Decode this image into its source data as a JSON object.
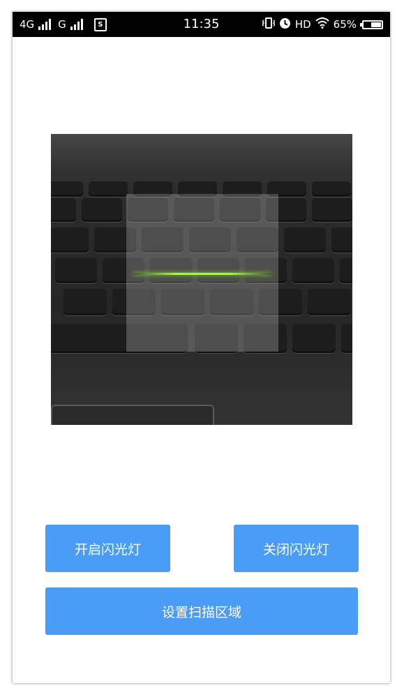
{
  "status_bar": {
    "network_1": "4G",
    "network_2": "G",
    "time": "11:35",
    "hd": "HD",
    "battery_percent": "65%",
    "battery_level": 0.65
  },
  "camera": {
    "icon": "camera-preview"
  },
  "buttons": {
    "flash_on": "开启闪光灯",
    "flash_off": "关闭闪光灯",
    "set_scan_area": "设置扫描区域"
  },
  "colors": {
    "button_bg": "#4a9cf5",
    "scan_line": "#9bff2b"
  }
}
